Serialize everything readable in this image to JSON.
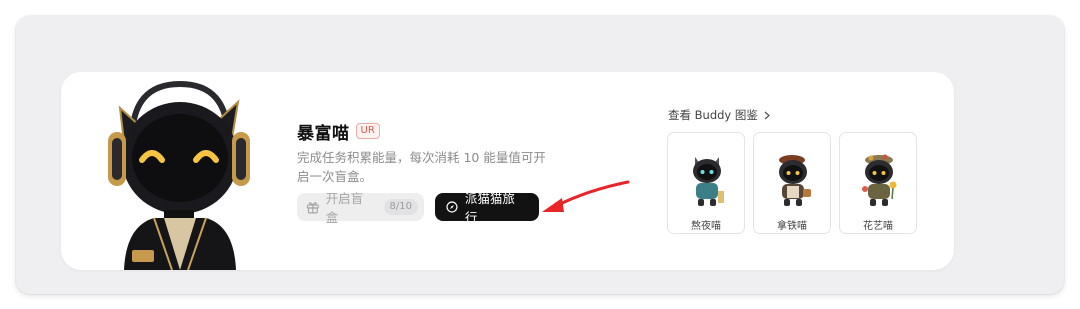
{
  "buddy": {
    "name": "暴富喵",
    "rarity": "UR",
    "description": "完成任务积累能量，每次消耗 10 能量值可开启一次盲盒。",
    "character_icon": "cat-astronaut-character"
  },
  "actions": {
    "open_box_label": "开启盲盒",
    "open_box_count": "8/10",
    "open_box_icon": "gift-icon",
    "travel_label": "派猫猫旅行",
    "travel_icon": "compass-icon"
  },
  "gallery": {
    "link_label": "查看 Buddy 图鉴",
    "items": [
      {
        "name": "熬夜喵",
        "icon": "hoodie-cat-icon"
      },
      {
        "name": "拿铁喵",
        "icon": "beret-cat-icon"
      },
      {
        "name": "花艺喵",
        "icon": "flower-cat-icon"
      }
    ]
  },
  "colors": {
    "rarity_red": "#e0584c",
    "arrow_red": "#e8262a",
    "travel_button": "#121212"
  }
}
